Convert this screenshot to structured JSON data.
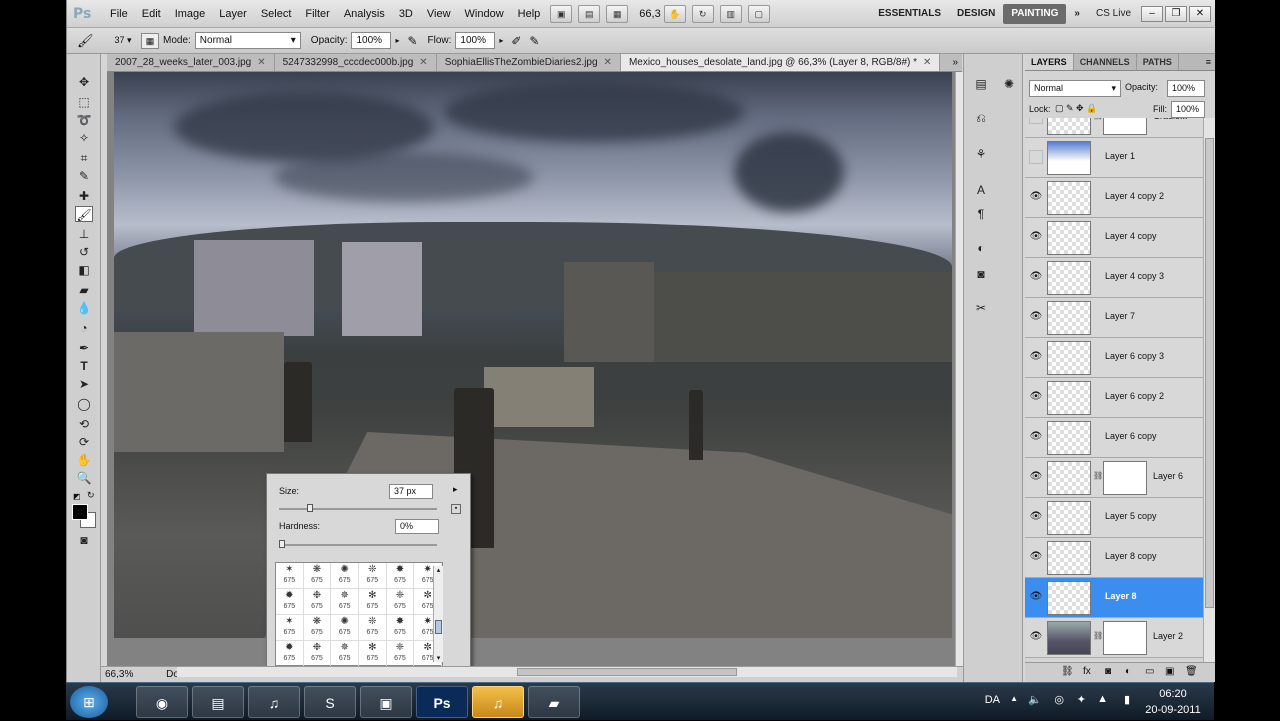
{
  "app": {
    "logo": "Ps",
    "menus": [
      "File",
      "Edit",
      "Image",
      "Layer",
      "Select",
      "Filter",
      "Analysis",
      "3D",
      "View",
      "Window",
      "Help"
    ],
    "zoom": "66,3",
    "workspaces": [
      "ESSENTIALS",
      "DESIGN",
      "PAINTING"
    ],
    "active_workspace": "PAINTING",
    "more": "»",
    "cs_live": "CS Live"
  },
  "options": {
    "brush_size": "37",
    "mode_label": "Mode:",
    "mode_value": "Normal",
    "opacity_label": "Opacity:",
    "opacity_value": "100%",
    "flow_label": "Flow:",
    "flow_value": "100%"
  },
  "tabs": [
    {
      "label": "2007_28_weeks_later_003.jpg"
    },
    {
      "label": "5247332998_cccdec000b.jpg"
    },
    {
      "label": "SophiaEllisTheZombieDiaries2.jpg"
    },
    {
      "label": "Mexico_houses_desolate_land.jpg @ 66,3% (Layer 8, RGB/8#) *"
    }
  ],
  "brush_popup": {
    "size_label": "Size:",
    "size_value": "37 px",
    "hardness_label": "Hardness:",
    "hardness_value": "0%",
    "size_fraction": 0.18,
    "hardness_fraction": 0.0,
    "preset_label": "675"
  },
  "status": {
    "zoom": "66,3%",
    "doc_label": "Doc"
  },
  "layers_panel": {
    "tabs": [
      "LAYERS",
      "CHANNELS",
      "PATHS"
    ],
    "blend_mode": "Normal",
    "opacity_label": "Opacity:",
    "opacity_value": "100%",
    "lock_label": "Lock:",
    "fill_label": "Fill:",
    "fill_value": "100%",
    "layers": [
      {
        "name": "Gradie...",
        "visible": false,
        "mask": true
      },
      {
        "name": "Layer 1",
        "visible": false,
        "mask": false
      },
      {
        "name": "Layer 4 copy 2",
        "visible": true,
        "mask": false
      },
      {
        "name": "Layer 4 copy",
        "visible": true,
        "mask": false
      },
      {
        "name": "Layer 4 copy 3",
        "visible": true,
        "mask": false
      },
      {
        "name": "Layer 7",
        "visible": true,
        "mask": false
      },
      {
        "name": "Layer 6 copy 3",
        "visible": true,
        "mask": false
      },
      {
        "name": "Layer 6 copy 2",
        "visible": true,
        "mask": false
      },
      {
        "name": "Layer 6 copy",
        "visible": true,
        "mask": false
      },
      {
        "name": "Layer 6",
        "visible": true,
        "mask": true
      },
      {
        "name": "Layer 5 copy",
        "visible": true,
        "mask": false
      },
      {
        "name": "Layer 8 copy",
        "visible": true,
        "mask": false
      },
      {
        "name": "Layer 8",
        "visible": true,
        "mask": false,
        "selected": true
      },
      {
        "name": "Layer 2",
        "visible": true,
        "mask": true
      }
    ]
  },
  "taskbar": {
    "language": "DA",
    "time": "06:20",
    "date": "20-09-2011"
  },
  "colors": {
    "selection": "#3b8ef0",
    "workspace_active": "#6b6b6b"
  }
}
